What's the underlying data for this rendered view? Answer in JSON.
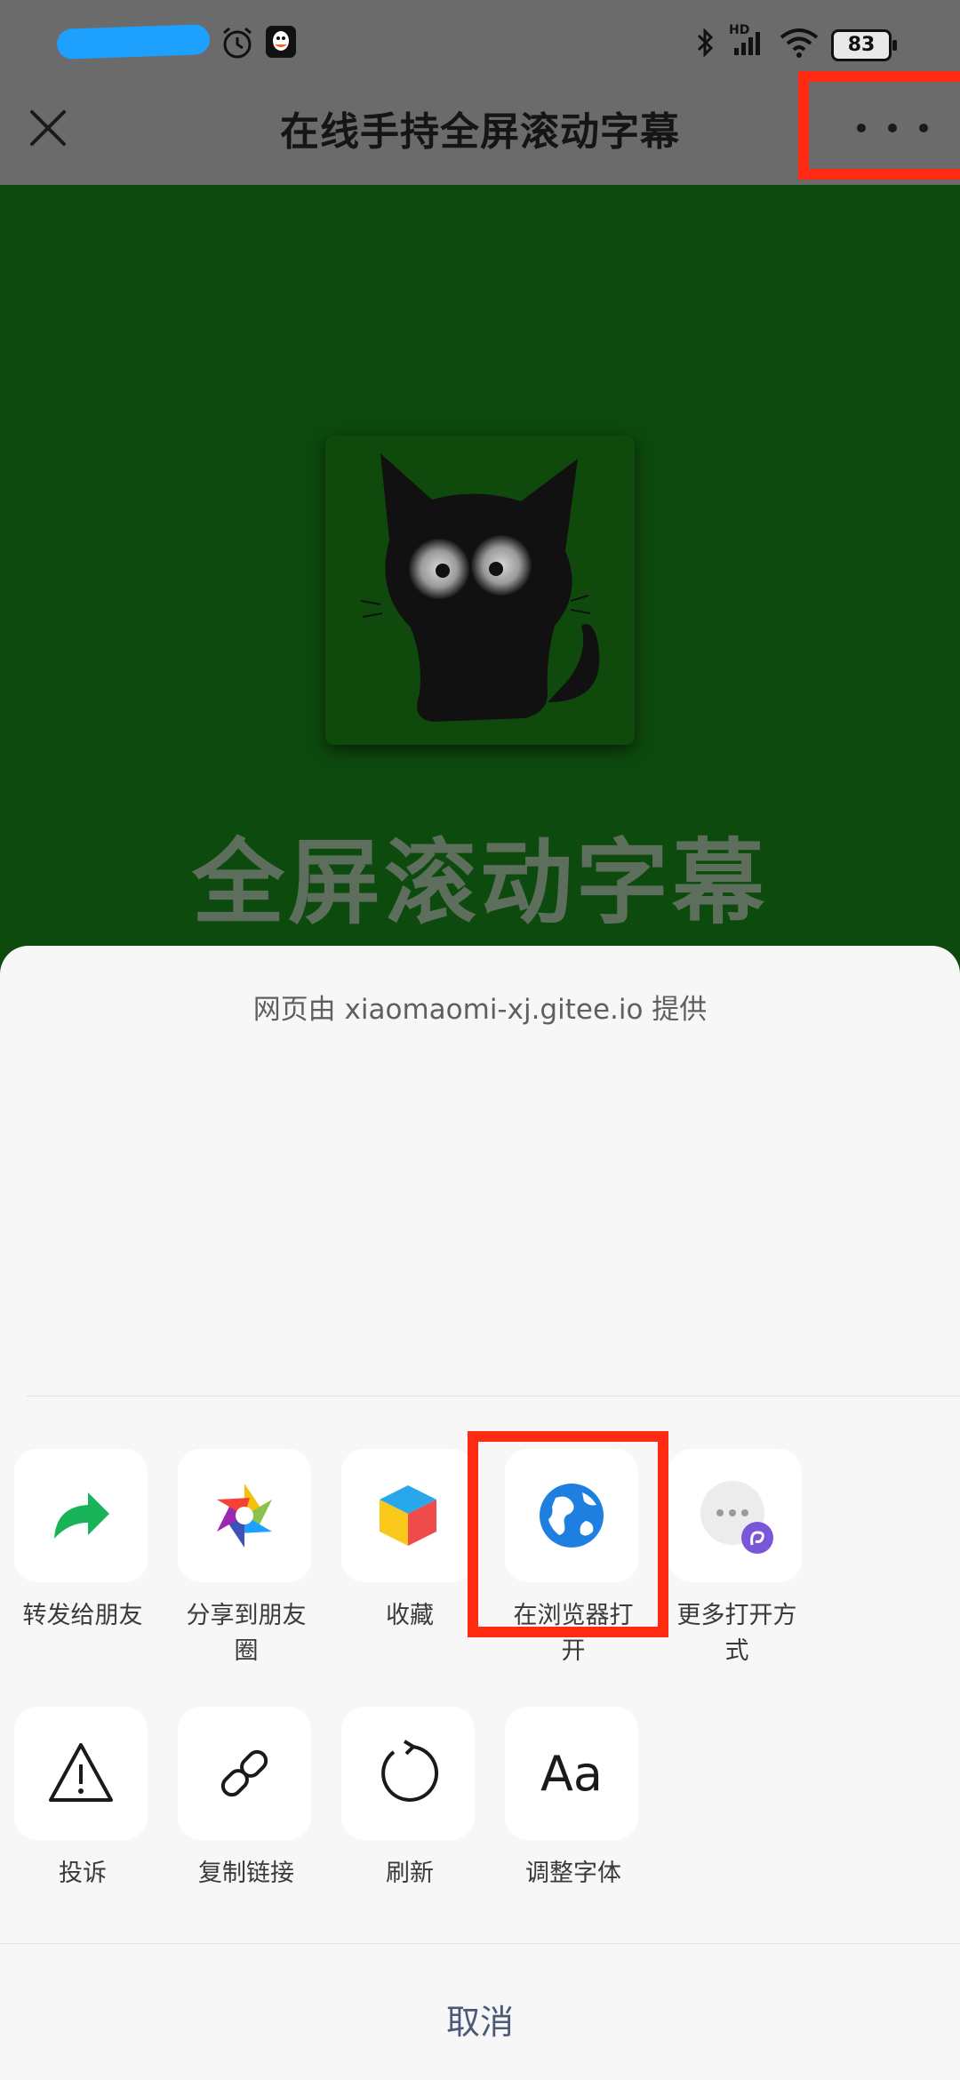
{
  "status_bar": {
    "battery": "83",
    "network_label": "HD"
  },
  "header": {
    "title": "在线手持全屏滚动字幕",
    "close_icon": "close-icon",
    "more_icon": "more-horizontal-icon"
  },
  "page": {
    "big_title": "全屏滚动字幕",
    "background_color": "#0d4a0e"
  },
  "sheet": {
    "provider_text": "网页由 xiaomaomi-xj.gitee.io 提供",
    "row1": [
      {
        "label": "转发给朋友",
        "icon": "forward-arrow-icon"
      },
      {
        "label": "分享到朋友圈",
        "icon": "moments-icon"
      },
      {
        "label": "收藏",
        "icon": "favorite-cube-icon"
      },
      {
        "label": "在浏览器打开",
        "icon": "browser-globe-icon"
      },
      {
        "label": "更多打开方式",
        "icon": "more-open-icon"
      }
    ],
    "row2": [
      {
        "label": "投诉",
        "icon": "warning-icon"
      },
      {
        "label": "复制链接",
        "icon": "link-icon"
      },
      {
        "label": "刷新",
        "icon": "refresh-icon"
      },
      {
        "label": "调整字体",
        "icon": "font-icon",
        "glyph": "Aa"
      }
    ],
    "cancel_label": "取消"
  },
  "colors": {
    "highlight": "#ff2a12",
    "top_bar": "#6b6b6b",
    "sheet_bg": "#f7f7f7",
    "cancel_text": "#4b5a78"
  }
}
